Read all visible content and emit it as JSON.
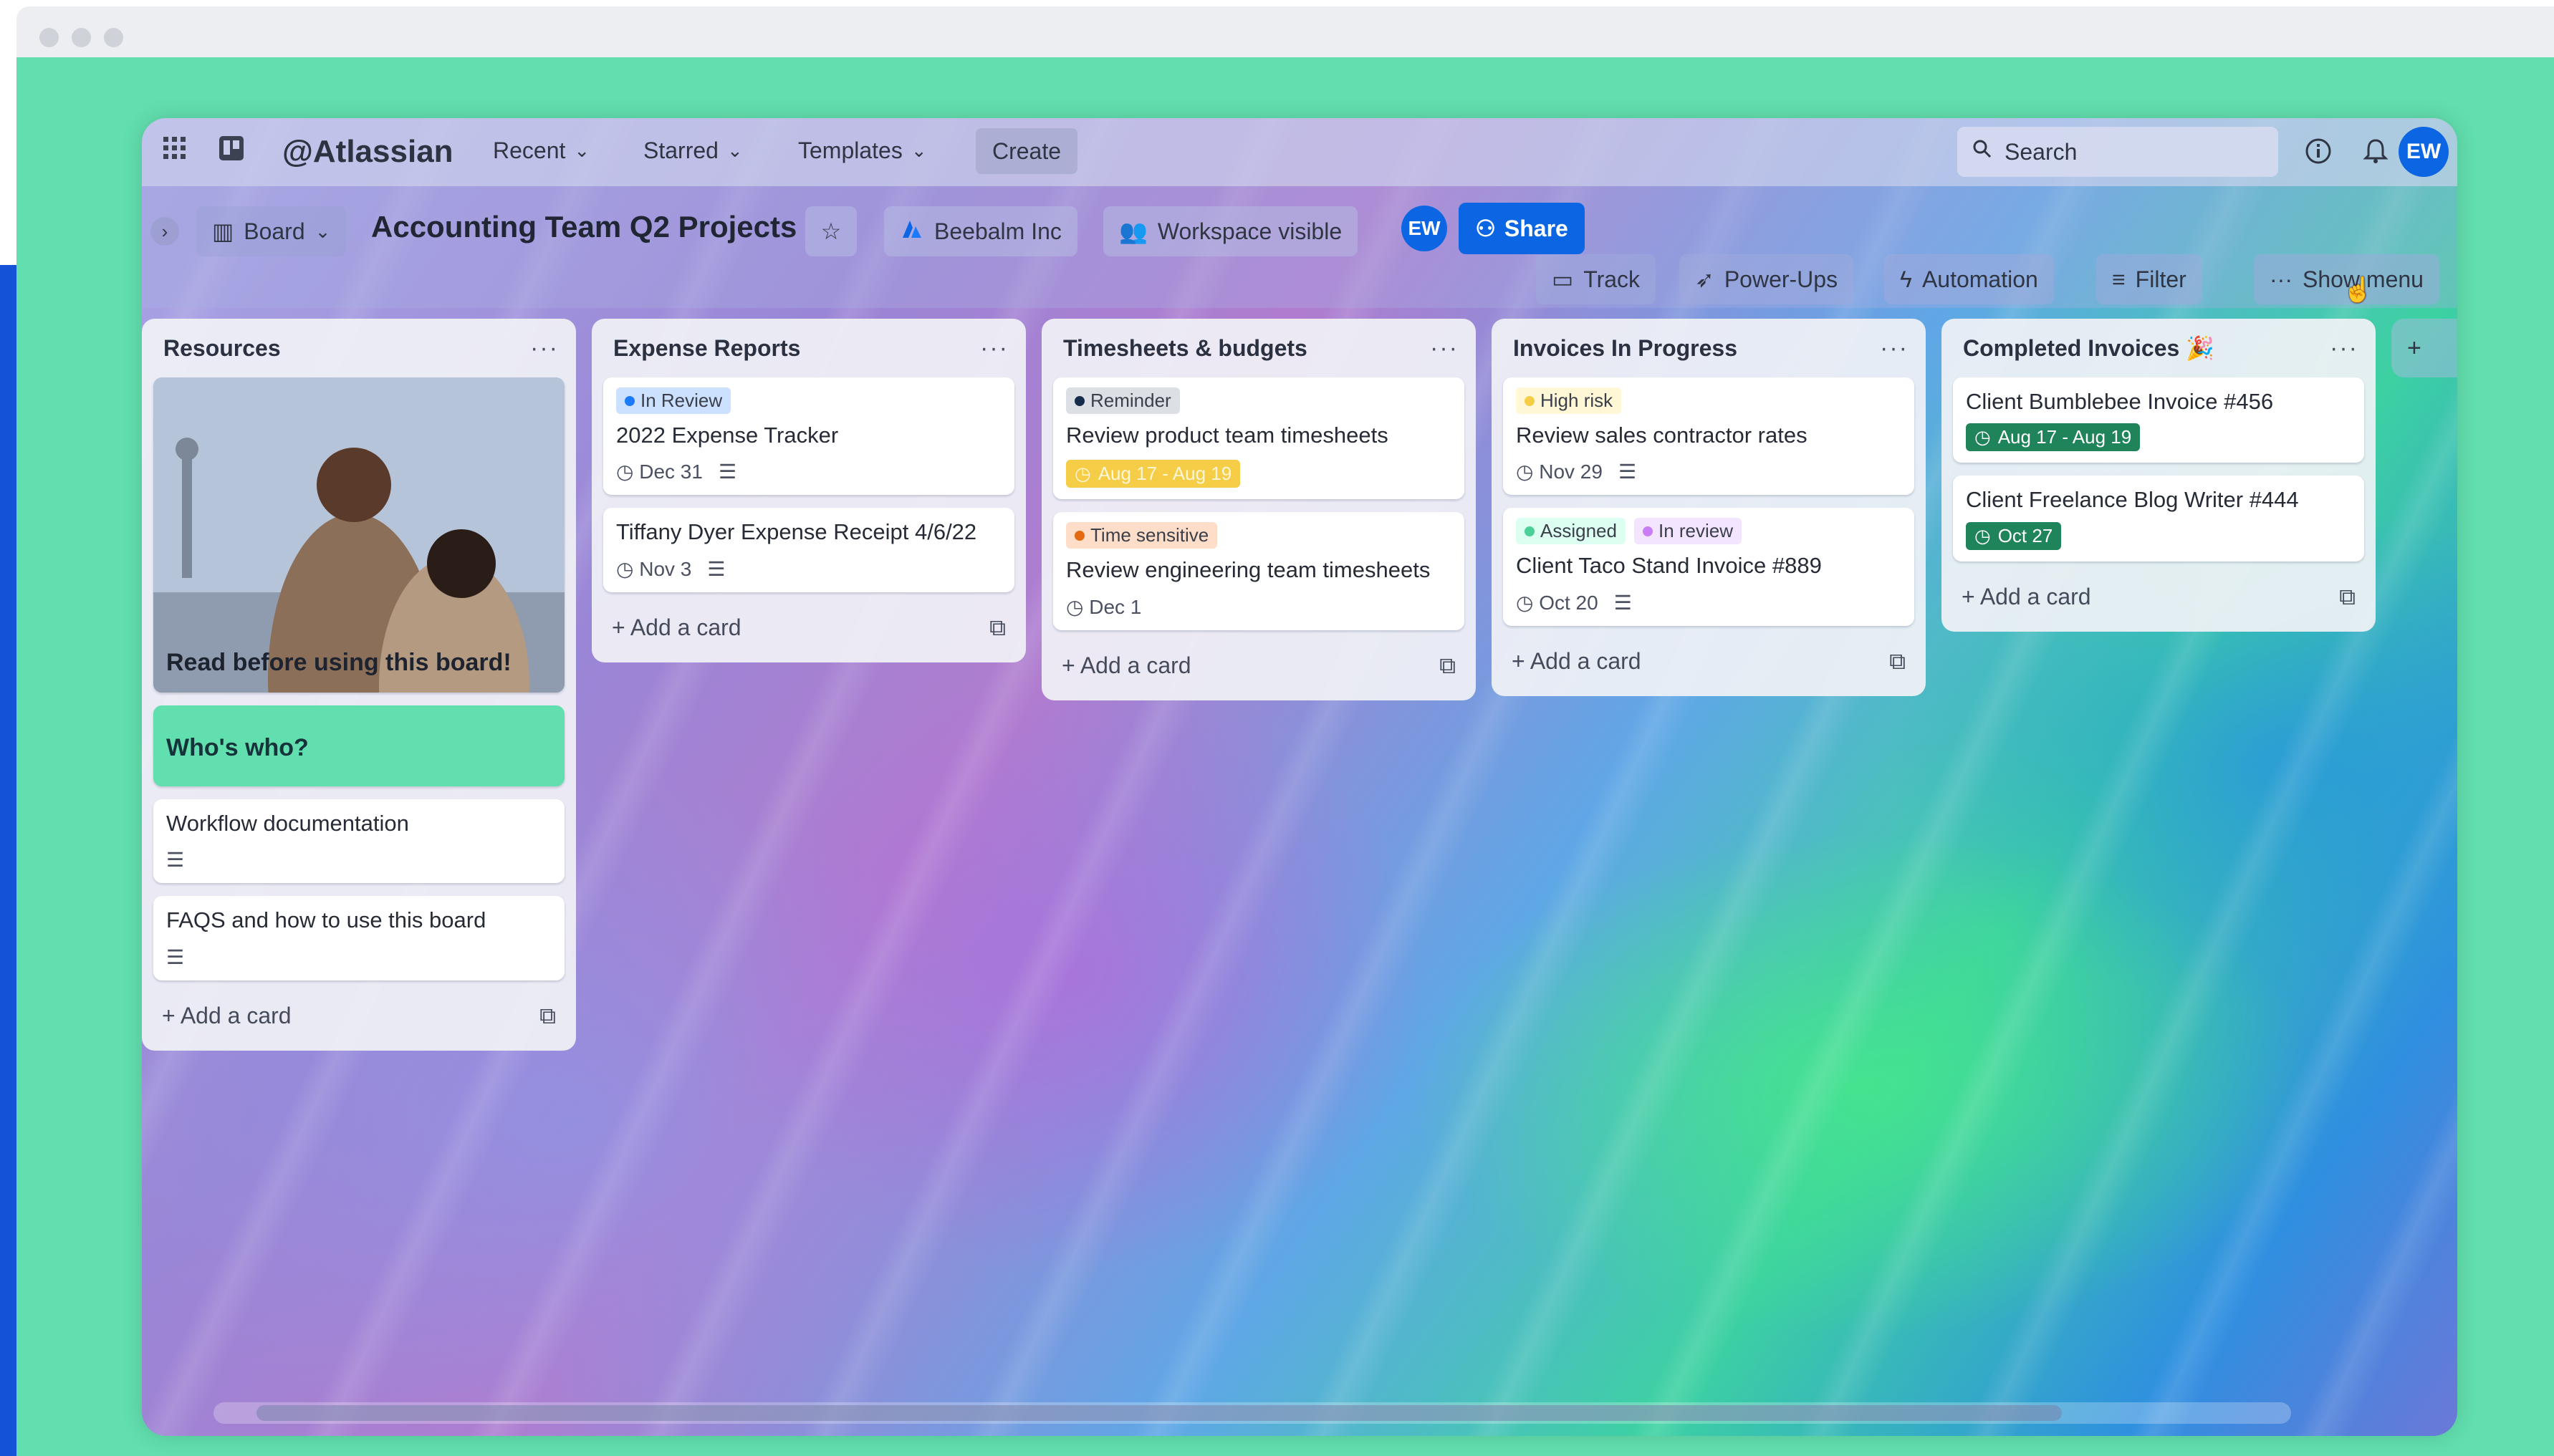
{
  "nav": {
    "brand": "@Atlassian",
    "recent": "Recent",
    "starred": "Starred",
    "templates": "Templates",
    "create": "Create",
    "search_placeholder": "Search",
    "avatar": "EW"
  },
  "board": {
    "view": "Board",
    "title": "Accounting Team Q2 Projects",
    "workspace": "Beebalm Inc",
    "visibility": "Workspace visible",
    "member": "EW",
    "share": "Share"
  },
  "toolbar": {
    "track": "Track",
    "powerups": "Power-Ups",
    "automation": "Automation",
    "filter": "Filter",
    "show_menu": "Show menu"
  },
  "add_card": "Add a card",
  "lists": [
    {
      "title": "Resources",
      "cover_card": "Read before using this board!",
      "cards": [
        {
          "title": "Who's who?"
        },
        {
          "title": "Workflow documentation"
        },
        {
          "title": "FAQS and how to use this board"
        }
      ]
    },
    {
      "title": "Expense Reports",
      "cards": [
        {
          "label": "In Review",
          "title": "2022 Expense Tracker",
          "date": "Dec 31"
        },
        {
          "title": "Tiffany Dyer Expense Receipt 4/6/22",
          "date": "Nov 3"
        }
      ]
    },
    {
      "title": "Timesheets & budgets",
      "cards": [
        {
          "label": "Reminder",
          "title": "Review product team timesheets",
          "date": "Aug 17 - Aug 19"
        },
        {
          "label": "Time sensitive",
          "title": "Review engineering team timesheets",
          "date": "Dec 1"
        }
      ]
    },
    {
      "title": "Invoices In Progress",
      "cards": [
        {
          "label": "High risk",
          "title": "Review sales contractor rates",
          "date": "Nov 29"
        },
        {
          "labels": [
            "Assigned",
            "In review"
          ],
          "title": "Client Taco Stand Invoice #889",
          "date": "Oct 20"
        }
      ]
    },
    {
      "title": "Completed Invoices 🎉",
      "cards": [
        {
          "title": "Client Bumblebee Invoice #456",
          "date": "Aug 17 - Aug 19"
        },
        {
          "title": "Client Freelance Blog Writer #444",
          "date": "Oct 27"
        }
      ]
    }
  ],
  "colors": {
    "accent": "#0c66e4",
    "done_green": "#1f845a",
    "warn_yellow": "#f5cd47",
    "frame_green": "#62dfae"
  }
}
